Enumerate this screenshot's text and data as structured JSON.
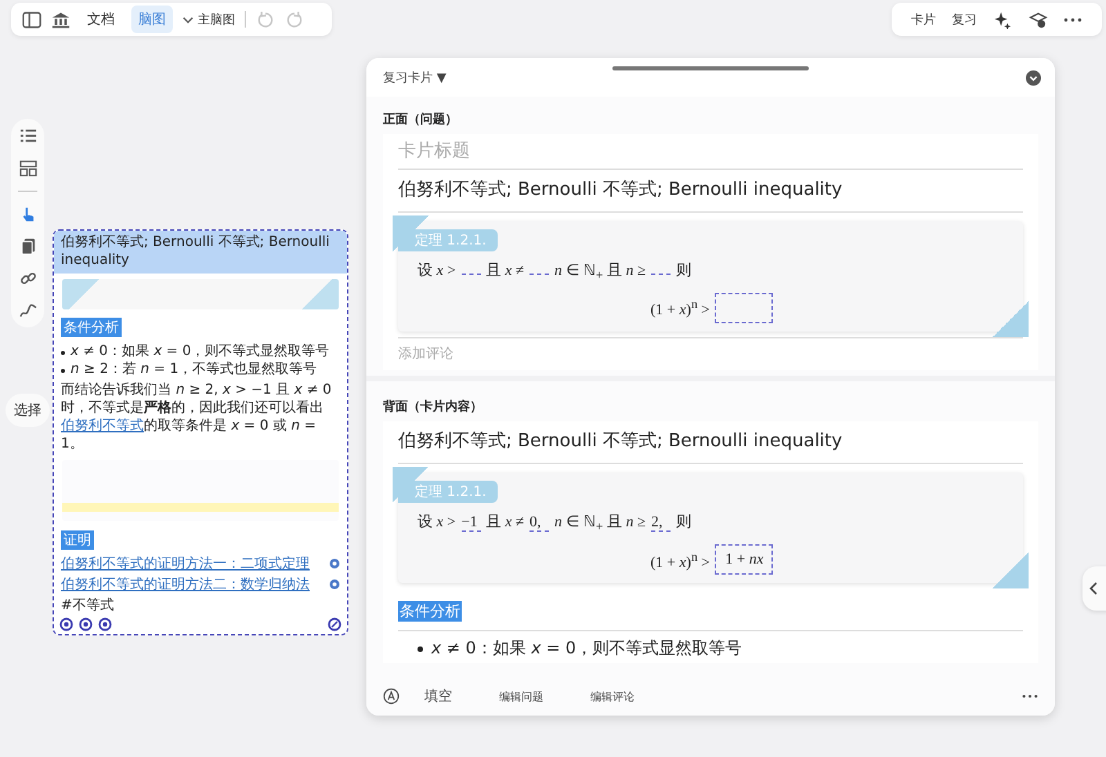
{
  "top_toolbar": {
    "tabs": [
      {
        "label": "文档",
        "selected": false
      },
      {
        "label": "脑图",
        "selected": true
      }
    ],
    "map_selector": "主脑图",
    "undo": {
      "disabled": true
    },
    "redo": {
      "disabled": true
    }
  },
  "right_toolbar": {
    "buttons": [
      "卡片",
      "复习"
    ]
  },
  "side_tools": [
    {
      "selected": false
    },
    {
      "selected": false
    },
    {
      "selected": true
    },
    {
      "selected": false
    },
    {
      "selected": false
    },
    {
      "selected": false
    }
  ],
  "select_button": "选择",
  "mindmap_card": {
    "title": "伯努利不等式; Bernoulli 不等式; Bernoulli inequality",
    "tag": "条件分析",
    "bullets": [
      "*x* ≠ 0：如果 *x* = 0，则不等式显然取等号",
      "*n* ≥ 2：若 *n* = 1，不等式也显然取等号"
    ],
    "paragraph": {
      "before": "而结论告诉我们当 *n* ≥ 2, *x* > −1 且 *x* ≠ 0 时，不等式是**严格**的，因此我们还可以看出",
      "link": "伯努利不等式",
      "after": "的取等条件是 *x* = 0 或 *n* = 1。"
    },
    "section_tag": "证明",
    "links": [
      "伯努利不等式的证明方法一：二项式定理",
      "伯努利不等式的证明方法二：数学归纳法"
    ],
    "hashtag": "#不等式"
  },
  "review_panel": {
    "title": "复习卡片 ▼",
    "front": {
      "heading": "正面（问题）",
      "title_placeholder": "卡片标题",
      "title": "伯努利不等式; Bernoulli 不等式; Bernoulli inequality",
      "theorem": {
        "label": "定理 1.2.1.",
        "segments": [
          "设 *x* >",
          "且 *x* ≠",
          "*n* ∈ ℕ$_{+}$ 且 *n* ≥",
          "则"
        ],
        "inequality": "(1 + *x*)$^{n}$ >"
      },
      "comment_placeholder": "添加评论"
    },
    "back": {
      "heading": "背面（卡片内容）",
      "title": "伯努利不等式; Bernoulli 不等式; Bernoulli inequality",
      "theorem": {
        "label": "定理 1.2.1.",
        "segments": [
          "设 *x* >",
          "且 *x* ≠",
          "*n* ∈ ℕ$_{+}$ 且 *n* ≥",
          "则"
        ],
        "answers": [
          "−1",
          "0,",
          "2,"
        ],
        "inequality": "(1 + *x*)$^{n}$ >",
        "result": "1 + *nx*"
      },
      "tag": "条件分析",
      "bullet": "*x* ≠ 0：如果 *x* = 0，则不等式显然取等号"
    },
    "bottom_bar": {
      "buttons": [
        "填空",
        "编辑问题",
        "编辑评论"
      ]
    }
  }
}
